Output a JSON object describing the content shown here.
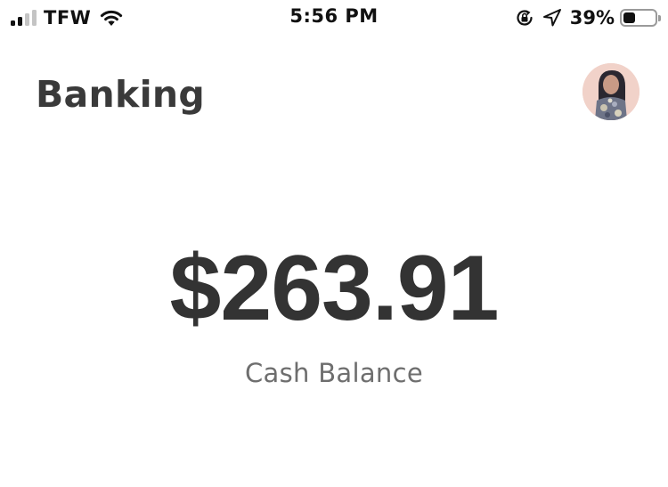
{
  "status_bar": {
    "carrier": "TFW",
    "time": "5:56 PM",
    "battery_percent": "39%",
    "battery_level": 0.39,
    "signal_bars_active": 2,
    "signal_bars_total": 4,
    "icons": [
      "cellular-signal-icon",
      "wifi-icon",
      "rotation-lock-icon",
      "location-arrow-icon",
      "battery-icon"
    ]
  },
  "header": {
    "title": "Banking"
  },
  "balance": {
    "amount": "$263.91",
    "label": "Cash Balance"
  },
  "colors": {
    "title": "#3a3a3a",
    "amount": "#333333",
    "label": "#6e6e6e",
    "avatar_bg": "#f2d4cc"
  }
}
